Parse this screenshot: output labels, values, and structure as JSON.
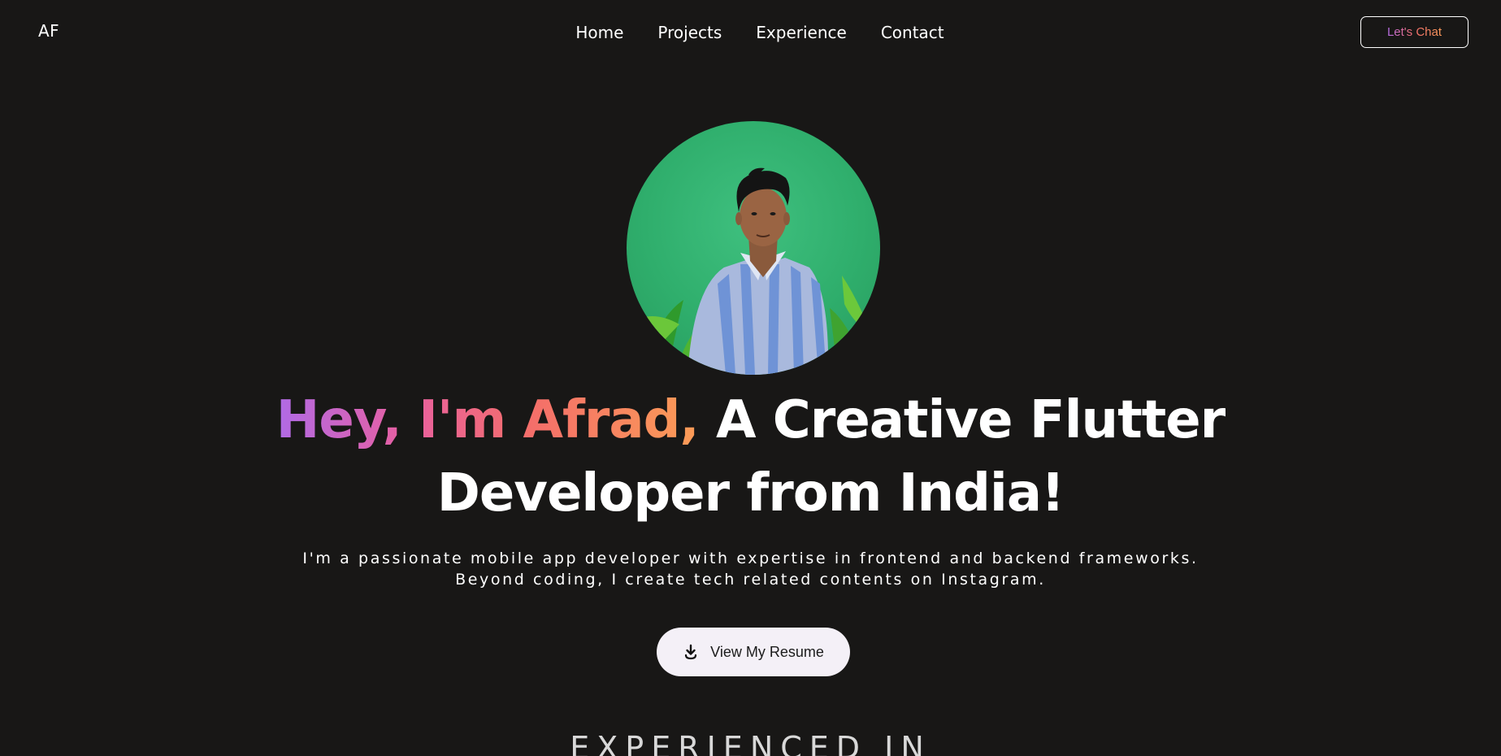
{
  "nav": {
    "logo": "AF",
    "links": [
      "Home",
      "Projects",
      "Experience",
      "Contact"
    ],
    "cta_label": "Let's Chat"
  },
  "hero": {
    "greeting": "Hey, I'm Afrad,",
    "headline_line1_rest": "A Creative Flutter",
    "headline_line2": "Developer from India!",
    "intro_line1": "I'm a passionate mobile app developer with expertise in frontend and backend frameworks.",
    "intro_line2": "Beyond coding, I create tech related contents on Instagram.",
    "resume_label": "View My Resume"
  },
  "sections": {
    "experienced_heading": "EXPERIENCED IN"
  },
  "colors": {
    "background": "#181716",
    "gradient_start": "#b06ae6",
    "gradient_mid": "#f46e6a",
    "gradient_end": "#fb9c56",
    "avatar_bg": "#2fae6c",
    "resume_button_bg": "#f4f0f7"
  },
  "icons": {
    "resume": "download-icon"
  }
}
